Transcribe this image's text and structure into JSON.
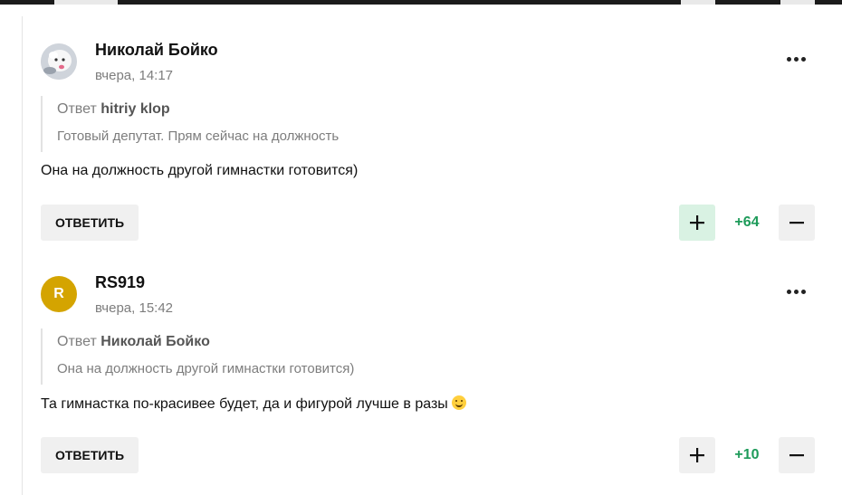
{
  "colors": {
    "score_positive": "#1e9b5a",
    "plus_active_bg": "#d9f2e3",
    "button_bg": "#f0f0f0",
    "avatar_rs919": "#d4a400"
  },
  "comments": [
    {
      "author": "Николай Бойко",
      "time": "вчера, 14:17",
      "avatar_icon": "user-photo-icon",
      "quote": {
        "prefix": "Ответ",
        "to_author": "hitriy klop",
        "text": "Готовый депутат. Прям сейчас на должность"
      },
      "text": "Она на должность другой гимнастки готовится)",
      "reply_label": "ОТВЕТИТЬ",
      "score": "+64",
      "plus_active": true
    },
    {
      "author": "RS919",
      "time": "вчера, 15:42",
      "avatar_letter": "R",
      "quote": {
        "prefix": "Ответ",
        "to_author": "Николай Бойко",
        "text": "Она на должность другой гимнастки готовится)"
      },
      "text": "Та гимнастка по-красивее будет, да и фигурой лучше в разы",
      "emoji": "smiling-face-icon",
      "reply_label": "ОТВЕТИТЬ",
      "score": "+10",
      "plus_active": false
    }
  ]
}
